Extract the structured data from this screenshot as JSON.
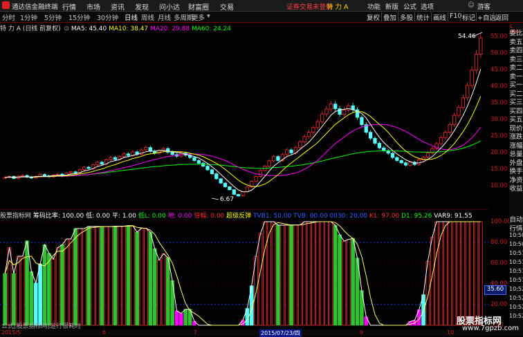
{
  "titlebar": {
    "app_title": "通达信金融终端",
    "menus": [
      "行情",
      "市场",
      "资讯",
      "发现",
      "问小达",
      "财富圈",
      "交易"
    ],
    "notice": "证券交易未登录",
    "stock": "特 力 A",
    "right_menus": [
      "功能",
      "新版",
      "公式",
      "选项"
    ],
    "guest": "游客"
  },
  "toolbar": {
    "periods": [
      "分时",
      "1分钟",
      "5分钟",
      "15分钟",
      "30分钟",
      "60分钟",
      "日线",
      "周线",
      "月线",
      "多周期",
      "更多"
    ],
    "active_period": "日线",
    "right_buttons": [
      "复权",
      "叠加",
      "多股",
      "统计",
      "画线",
      "F10",
      "标记",
      "+自选",
      "返回"
    ]
  },
  "ma_header": {
    "name": "特 力 A (日线 前复权)",
    "ma5": "MA5: 45.40",
    "ma10": "MA10: 38.47",
    "ma20": "MA20: 29.88",
    "ma60": "MA60: 24.24",
    "colors": {
      "ma5": "#ffffff",
      "ma10": "#ffff00",
      "ma20": "#ff00ff",
      "ma60": "#00ff00"
    }
  },
  "price_axis": [
    "55.00",
    "50.00",
    "45.00",
    "40.00",
    "35.00",
    "30.00",
    "25.00",
    "20.00",
    "15.00",
    "10.00"
  ],
  "annotations": {
    "high": "54.46",
    "low": "6.67"
  },
  "side_panel": [
    "委比",
    "卖五",
    "卖四",
    "卖三",
    "卖二",
    "卖一",
    "买一",
    "买二",
    "买三",
    "买四",
    "买五",
    "现价",
    "涨跌",
    "涨幅",
    "总量",
    "外盘",
    "换手",
    "净资",
    "收益"
  ],
  "side_panel2": [
    "自动",
    "行情",
    "10:50",
    "10:50",
    "10:51",
    "10:51",
    "10:51",
    "10:51",
    "10:52",
    "10:52",
    "10:52",
    "10:52"
  ],
  "indicator_header": {
    "name": "股票指标网",
    "items": [
      {
        "text": "筹码比率: 100.00",
        "color": "#ffffff"
      },
      {
        "text": "低: 0.00",
        "color": "#ffffff"
      },
      {
        "text": "平: 1.00",
        "color": "#ffffff"
      },
      {
        "text": "低L: 0.00",
        "color": "#00ff00"
      },
      {
        "text": "地: 0.00",
        "color": "#ff00ff"
      },
      {
        "text": "倍幅: 0.00",
        "color": "#ff3030"
      },
      {
        "text": "超级反弹",
        "color": "#ffff00"
      },
      {
        "text": "TVB1: 50.00",
        "color": "#3060ff"
      },
      {
        "text": "TVB: 00.00",
        "color": "#3060ff"
      },
      {
        "text": "0030: 20.00",
        "color": "#3060ff"
      },
      {
        "text": "K1: 97.00",
        "color": "#ff3030"
      },
      {
        "text": "D1: 95.26",
        "color": "#00ff00"
      },
      {
        "text": "VAR9: 91.55",
        "color": "#ffffff"
      }
    ]
  },
  "indicator_axis": [
    "100.00",
    "80.00",
    "60.00",
    "40.00",
    "20.00",
    "0.00"
  ],
  "popbox": "35.60",
  "formula_text": "公式[股票指标网]运行很耗时",
  "dates": [
    "2015/5",
    "6",
    "7",
    "2015/07/23/四",
    "9",
    "10"
  ],
  "watermark": {
    "main": "股票指标网",
    "url": "www.7gpzb.com"
  },
  "chart_data": {
    "type": "candlestick",
    "price_range": [
      5,
      57
    ],
    "closes": [
      12.5,
      12.8,
      12.2,
      12.9,
      13.1,
      12.6,
      12.3,
      12.8,
      13.4,
      13.0,
      12.7,
      13.2,
      13.5,
      12.9,
      13.8,
      14.2,
      13.9,
      14.8,
      15.6,
      15.2,
      16.3,
      17.1,
      16.5,
      17.8,
      18.5,
      17.9,
      18.8,
      19.6,
      19.1,
      20.2,
      19.5,
      20.8,
      21.5,
      20.4,
      19.8,
      20.6,
      21.2,
      20.1,
      19.4,
      18.9,
      19.8,
      19.2,
      18.5,
      17.6,
      16.8,
      15.9,
      14.8,
      13.6,
      12.1,
      10.8,
      9.7,
      8.8,
      7.4,
      6.9,
      8.2,
      9.6,
      11.3,
      12.8,
      14.6,
      15.9,
      17.5,
      18.8,
      17.6,
      19.4,
      20.8,
      19.9,
      21.5,
      23.2,
      24.8,
      26.1,
      27.5,
      29.3,
      31.6,
      33.1,
      34.6,
      33.2,
      31.5,
      32.8,
      34.1,
      32.9,
      30.6,
      28.4,
      26.1,
      24.3,
      22.8,
      21.4,
      20.6,
      19.8,
      18.5,
      17.6,
      16.9,
      16.2,
      17.1,
      16.4,
      17.8,
      18.6,
      19.9,
      21.2,
      22.7,
      24.5,
      26.1,
      28.4,
      31.2,
      33.6,
      36.5,
      40.2,
      44.8,
      49.6,
      54.5
    ]
  }
}
